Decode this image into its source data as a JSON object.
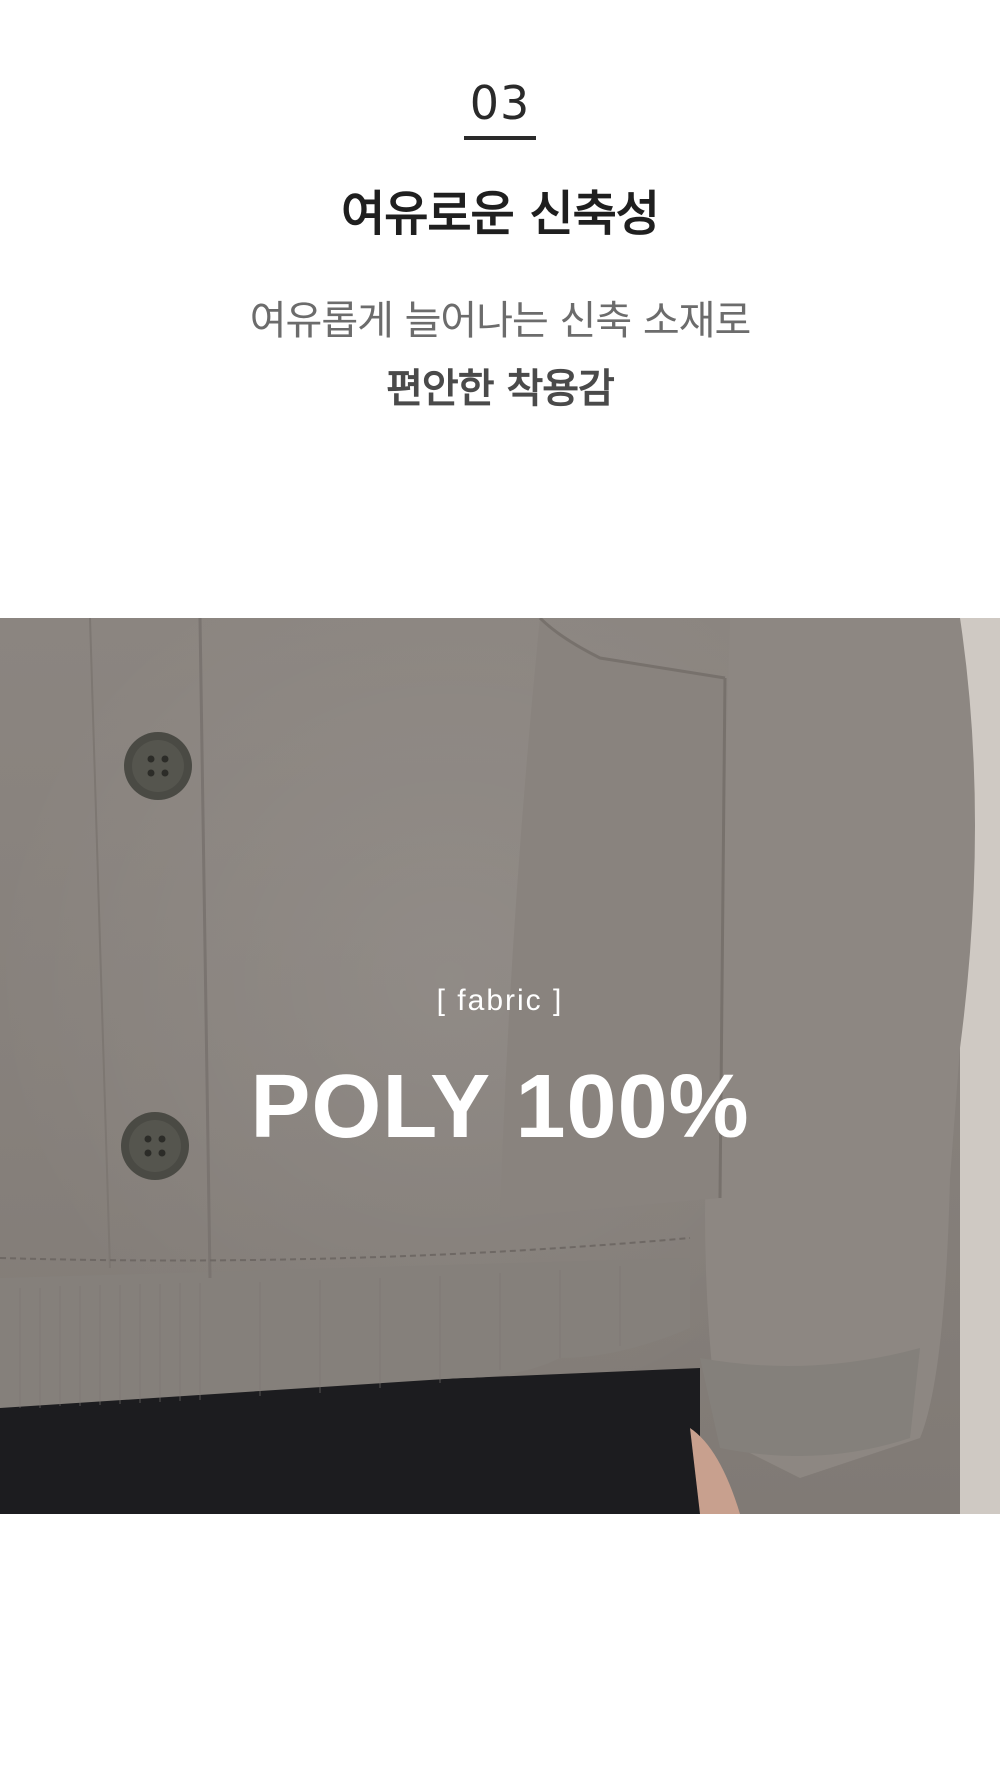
{
  "section": {
    "number": "03",
    "title": "여유로운 신축성",
    "description_line1": "여유롭게 늘어나는 신축 소재로",
    "description_line2": "편안한 착용감"
  },
  "photo": {
    "fabric_label": "[ fabric ]",
    "fabric_value": "POLY 100%"
  }
}
